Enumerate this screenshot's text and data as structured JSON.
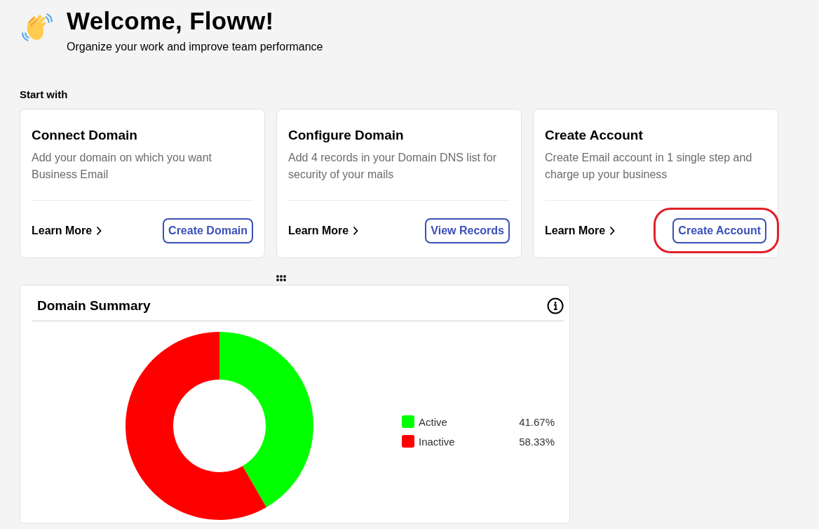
{
  "header": {
    "title": "Welcome, Floww!",
    "subtitle": "Organize your work and improve team performance"
  },
  "section_title": "Start with",
  "cards": [
    {
      "title": "Connect Domain",
      "description": "Add your domain on which you want Business Email",
      "link": "Learn More",
      "button": "Create Domain",
      "highlighted": false
    },
    {
      "title": "Configure Domain",
      "description": "Add 4 records in your Domain DNS list for security of your mails",
      "link": "Learn More",
      "button": "View Records",
      "highlighted": false
    },
    {
      "title": "Create Account",
      "description": "Create Email account in 1 single step and charge up your business",
      "link": "Learn More",
      "button": "Create Account",
      "highlighted": true
    }
  ],
  "summary": {
    "title": "Domain Summary",
    "legend": [
      {
        "value": "41.67%",
        "color": "#00ff00"
      },
      {
        "value": "58.33%",
        "color": "#ff0000"
      }
    ],
    "chart_data": {
      "type": "donut",
      "categories": [
        "Active",
        "Inactive"
      ],
      "values": [
        41.67,
        58.33
      ]
    }
  }
}
